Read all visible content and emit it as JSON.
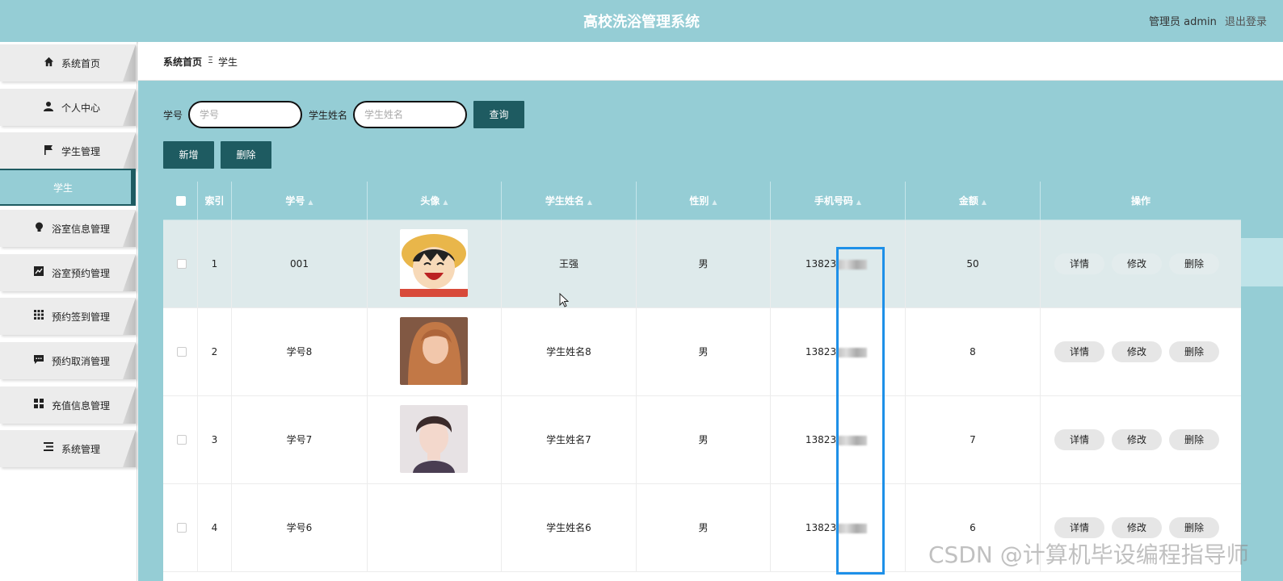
{
  "header": {
    "title": "高校洗浴管理系统",
    "role_user": "管理员 admin",
    "logout": "退出登录"
  },
  "sidebar": {
    "items": [
      {
        "label": "系统首页",
        "icon": "home-icon"
      },
      {
        "label": "个人中心",
        "icon": "user-icon"
      },
      {
        "label": "学生管理",
        "icon": "flag-icon"
      },
      {
        "label": "浴室信息管理",
        "icon": "bulb-icon"
      },
      {
        "label": "浴室预约管理",
        "icon": "chart-icon"
      },
      {
        "label": "预约签到管理",
        "icon": "grid-icon"
      },
      {
        "label": "预约取消管理",
        "icon": "chat-icon"
      },
      {
        "label": "充值信息管理",
        "icon": "apps-icon"
      },
      {
        "label": "系统管理",
        "icon": "list-icon"
      }
    ],
    "active_sub": "学生"
  },
  "breadcrumb": {
    "home": "系统首页",
    "separator": "Ξ",
    "current": "学生"
  },
  "search": {
    "student_id_label": "学号",
    "student_id_placeholder": "学号",
    "name_label": "学生姓名",
    "name_placeholder": "学生姓名",
    "query_button": "查询"
  },
  "toolbar": {
    "add": "新增",
    "delete": "删除"
  },
  "table": {
    "columns": [
      "索引",
      "学号",
      "头像",
      "学生姓名",
      "性别",
      "手机号码",
      "金额",
      "操作"
    ],
    "rows": [
      {
        "index": "1",
        "student_id": "001",
        "name": "王强",
        "gender": "男",
        "phone": "13823",
        "amount": "50"
      },
      {
        "index": "2",
        "student_id": "学号8",
        "name": "学生姓名8",
        "gender": "男",
        "phone": "13823",
        "amount": "8"
      },
      {
        "index": "3",
        "student_id": "学号7",
        "name": "学生姓名7",
        "gender": "男",
        "phone": "13823",
        "amount": "7"
      },
      {
        "index": "4",
        "student_id": "学号6",
        "name": "学生姓名6",
        "gender": "男",
        "phone": "13823",
        "amount": "6"
      }
    ],
    "actions": {
      "detail": "详情",
      "edit": "修改",
      "delete": "删除"
    }
  },
  "colors": {
    "header_bg": "#95cdd5",
    "button_dark": "#1e5b61",
    "highlight_box": "#1e90e8"
  },
  "watermark": "CSDN @计算机毕设编程指导师"
}
